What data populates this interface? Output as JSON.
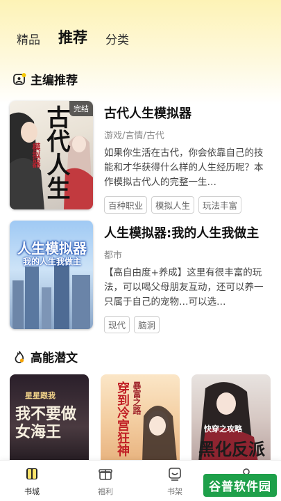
{
  "top_tabs": [
    "精品",
    "推荐",
    "分类"
  ],
  "section_editor": {
    "title": "主编推荐"
  },
  "books": [
    {
      "title": "古代人生模拟器",
      "meta": "游戏/言情/古代",
      "desc": "如果你生活在古代，你会依靠自己的技能和才华获得什么样的人生经历呢？本作模拟古代人的完整一生…",
      "tags": [
        "百种职业",
        "模拟人生",
        "玩法丰富"
      ],
      "badge": "完结",
      "cover_text": "古代人生",
      "cover_sub": "模拟器"
    },
    {
      "title": "人生模拟器:我的人生我做主",
      "meta": "都市",
      "desc": "【高自由度+养成】这里有很丰富的玩法，可以喝父母朋友互动，还可以养一只属于自己的宠物…可以选…",
      "tags": [
        "现代",
        "脑洞"
      ],
      "cover_text": "人生模拟器",
      "cover_sub": "我的人生我做主"
    }
  ],
  "section_potential": {
    "title": "高能潜文"
  },
  "small_covers": [
    {
      "text": "我不要做女海王",
      "sub": "星星跟我"
    },
    {
      "text": "穿到冷宫狂神",
      "sub": "暴富之路"
    },
    {
      "text": "黑化反派",
      "sub": "快穿之攻略"
    }
  ],
  "bottom_tabs": [
    "书城",
    "福利",
    "书架",
    "我的"
  ],
  "watermark": "谷普软件园",
  "colors": {
    "accent": "#fbe36a",
    "tag_border": "#cfcfcf"
  }
}
